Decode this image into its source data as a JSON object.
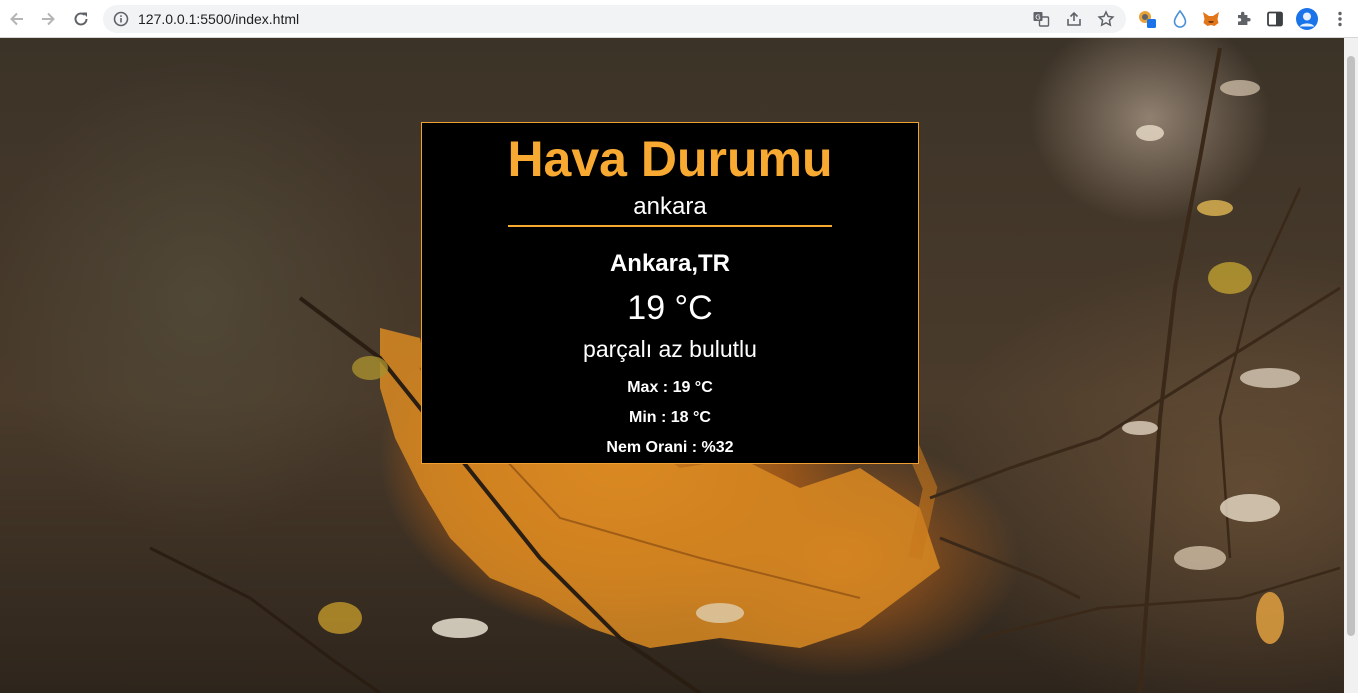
{
  "browser": {
    "url": "127.0.0.1:5500/index.html",
    "back_icon": "arrow-left-icon",
    "forward_icon": "arrow-right-icon",
    "reload_icon": "reload-icon",
    "omnibox_actions": [
      "translate-icon",
      "share-icon",
      "bookmark-star-icon"
    ],
    "extensions": [
      "extension-badge-icon",
      "water-drop-icon",
      "metamask-fox-icon",
      "puzzle-extensions-icon",
      "side-panel-icon",
      "profile-avatar-icon",
      "kebab-menu-icon"
    ]
  },
  "weather": {
    "title": "Hava Durumu",
    "search_value": "ankara",
    "city": "Ankara,TR",
    "temperature": "19 °C",
    "description": "parçalı az bulutlu",
    "max": "Max : 19 °C",
    "min": "Min : 18 °C",
    "humidity": "Nem Orani : %32"
  },
  "colors": {
    "accent": "#f7a931",
    "card_bg": "#000000",
    "text": "#ffffff"
  }
}
